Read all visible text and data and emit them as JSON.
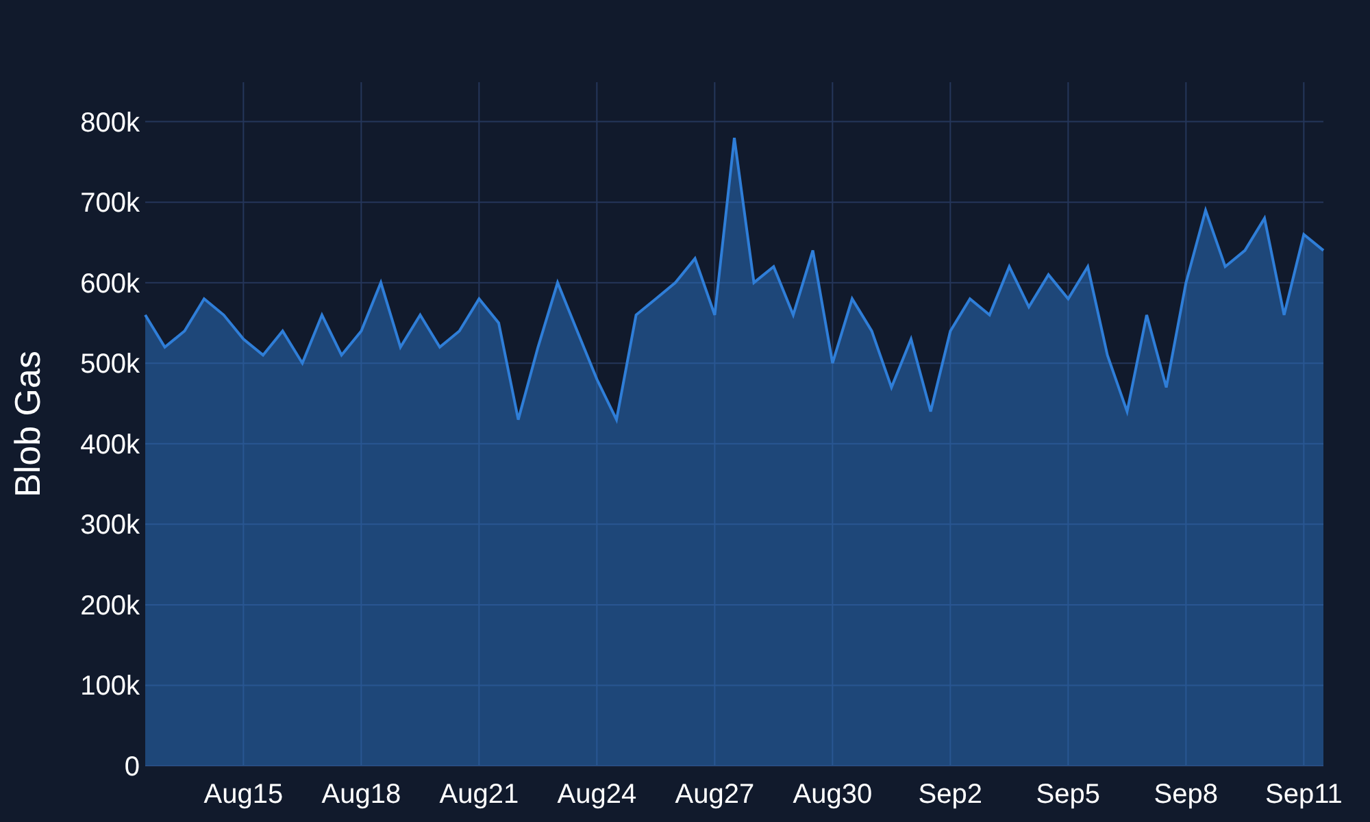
{
  "chart_data": {
    "type": "area",
    "ylabel": "Blob Gas",
    "categories": [
      null,
      null,
      null,
      null,
      null,
      "Aug15",
      null,
      null,
      null,
      null,
      null,
      "Aug18",
      null,
      null,
      null,
      null,
      null,
      "Aug21",
      null,
      null,
      null,
      null,
      null,
      "Aug24",
      null,
      null,
      null,
      null,
      null,
      "Aug27",
      null,
      null,
      null,
      null,
      null,
      "Aug30",
      null,
      null,
      null,
      null,
      null,
      "Sep2",
      null,
      null,
      null,
      null,
      null,
      "Sep5",
      null,
      null,
      null,
      null,
      null,
      "Sep8",
      null,
      null,
      null,
      null,
      null,
      "Sep11",
      null
    ],
    "series": [
      {
        "color": "#2f7ed8",
        "values": [
          560000,
          520000,
          540000,
          580000,
          560000,
          530000,
          510000,
          540000,
          500000,
          560000,
          510000,
          540000,
          600000,
          520000,
          560000,
          520000,
          540000,
          580000,
          550000,
          430000,
          520000,
          600000,
          540000,
          480000,
          430000,
          560000,
          580000,
          600000,
          630000,
          560000,
          780000,
          600000,
          620000,
          560000,
          640000,
          500000,
          580000,
          540000,
          470000,
          530000,
          440000,
          540000,
          580000,
          560000,
          620000,
          570000,
          610000,
          580000,
          620000,
          510000,
          440000,
          560000,
          470000,
          600000,
          690000,
          620000,
          640000,
          680000,
          560000,
          660000,
          640000
        ]
      }
    ],
    "ylim": [
      0,
      849000
    ],
    "grid": true,
    "yticks": [
      {
        "value": 0,
        "label": "0"
      },
      {
        "value": 100000,
        "label": "100k"
      },
      {
        "value": 200000,
        "label": "200k"
      },
      {
        "value": 300000,
        "label": "300k"
      },
      {
        "value": 400000,
        "label": "400k"
      },
      {
        "value": 500000,
        "label": "500k"
      },
      {
        "value": 600000,
        "label": "600k"
      },
      {
        "value": 700000,
        "label": "700k"
      },
      {
        "value": 800000,
        "label": "800k"
      }
    ]
  }
}
